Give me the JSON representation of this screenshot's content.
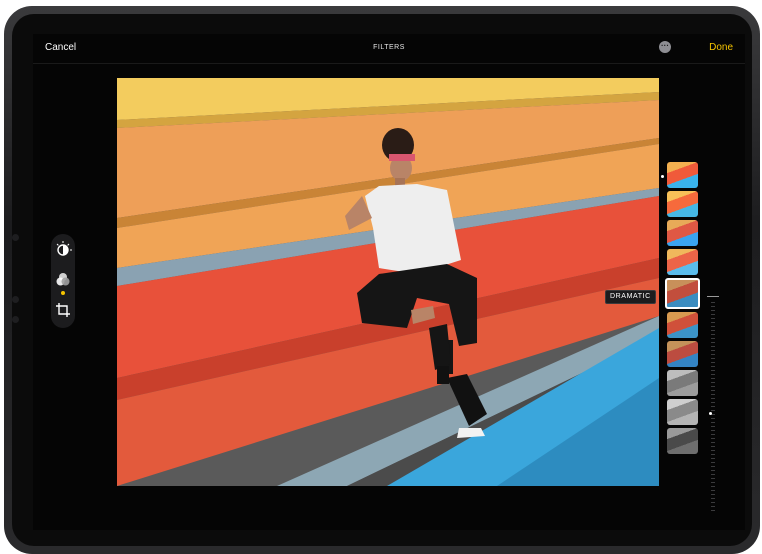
{
  "header": {
    "cancel_label": "Cancel",
    "title": "FILTERS",
    "more_icon": "ellipsis-circle-icon",
    "done_label": "Done"
  },
  "tools": [
    {
      "name": "adjust",
      "icon": "adjust-dial-icon",
      "active": false
    },
    {
      "name": "filters",
      "icon": "filters-circles-icon",
      "active": true
    },
    {
      "name": "crop",
      "icon": "crop-rotate-icon",
      "active": false
    }
  ],
  "filters": {
    "selected_label": "DRAMATIC",
    "thumbnails": [
      {
        "style": "vivid"
      },
      {
        "style": "vivid-warm"
      },
      {
        "style": "vivid-cool"
      },
      {
        "style": "dramatic-light"
      },
      {
        "style": "dramatic",
        "selected": true
      },
      {
        "style": "dramatic-warm"
      },
      {
        "style": "dramatic-cool"
      },
      {
        "style": "mono"
      },
      {
        "style": "silvertone"
      },
      {
        "style": "noir"
      }
    ]
  },
  "intensity": {
    "value_fraction": 0.48
  },
  "colors": {
    "accent": "#f5c400",
    "background": "#050505",
    "bench_yellow": "#f0c458",
    "bench_orange": "#e89a52",
    "bench_red": "#e84c34",
    "bench_blue": "#3aa6dc"
  }
}
